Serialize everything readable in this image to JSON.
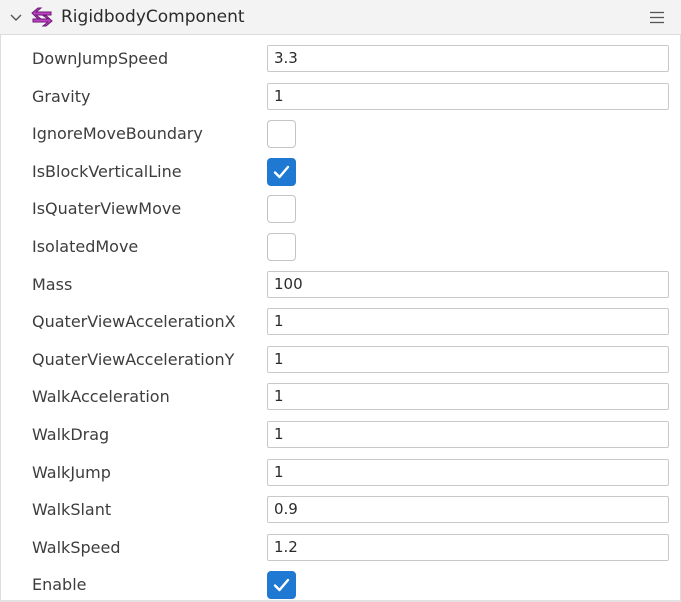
{
  "component": {
    "title": "RigidbodyComponent",
    "icon": "rigidbody-component-icon",
    "expand_icon": "chevron-down-icon",
    "menu_icon": "hamburger-menu-icon"
  },
  "colors": {
    "header_bg": "#f3f3f3",
    "checkbox_checked": "#1f78d1",
    "icon_purple": "#c040c8"
  },
  "properties": [
    {
      "label": "DownJumpSpeed",
      "type": "text",
      "value": "3.3"
    },
    {
      "label": "Gravity",
      "type": "text",
      "value": "1"
    },
    {
      "label": "IgnoreMoveBoundary",
      "type": "checkbox",
      "checked": false
    },
    {
      "label": "IsBlockVerticalLine",
      "type": "checkbox",
      "checked": true
    },
    {
      "label": "IsQuaterViewMove",
      "type": "checkbox",
      "checked": false
    },
    {
      "label": "IsolatedMove",
      "type": "checkbox",
      "checked": false
    },
    {
      "label": "Mass",
      "type": "text",
      "value": "100"
    },
    {
      "label": "QuaterViewAccelerationX",
      "type": "text",
      "value": "1"
    },
    {
      "label": "QuaterViewAccelerationY",
      "type": "text",
      "value": "1"
    },
    {
      "label": "WalkAcceleration",
      "type": "text",
      "value": "1"
    },
    {
      "label": "WalkDrag",
      "type": "text",
      "value": "1"
    },
    {
      "label": "WalkJump",
      "type": "text",
      "value": "1"
    },
    {
      "label": "WalkSlant",
      "type": "text",
      "value": "0.9"
    },
    {
      "label": "WalkSpeed",
      "type": "text",
      "value": "1.2"
    },
    {
      "label": "Enable",
      "type": "checkbox",
      "checked": true
    }
  ]
}
